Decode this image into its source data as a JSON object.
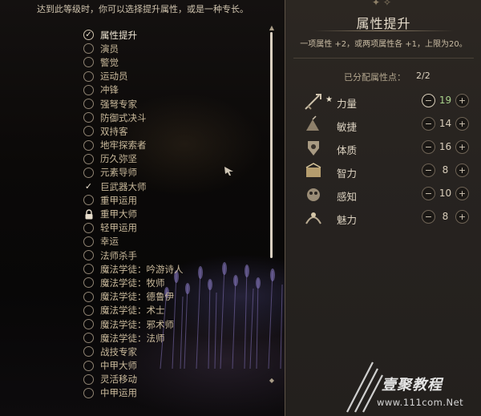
{
  "intro_text": "达到此等级时，你可以选择提升属性，或是一种专长。",
  "feats": [
    {
      "label": "属性提升",
      "state": "checked-circle"
    },
    {
      "label": "演员",
      "state": "empty"
    },
    {
      "label": "警觉",
      "state": "empty"
    },
    {
      "label": "运动员",
      "state": "empty"
    },
    {
      "label": "冲锋",
      "state": "empty"
    },
    {
      "label": "强弩专家",
      "state": "empty"
    },
    {
      "label": "防御式决斗",
      "state": "empty"
    },
    {
      "label": "双持客",
      "state": "empty"
    },
    {
      "label": "地牢探索者",
      "state": "empty"
    },
    {
      "label": "历久弥坚",
      "state": "empty"
    },
    {
      "label": "元素导师",
      "state": "empty"
    },
    {
      "label": "巨武器大师",
      "state": "check"
    },
    {
      "label": "重甲运用",
      "state": "empty"
    },
    {
      "label": "重甲大师",
      "state": "locked"
    },
    {
      "label": "轻甲运用",
      "state": "empty"
    },
    {
      "label": "幸运",
      "state": "empty"
    },
    {
      "label": "法师杀手",
      "state": "empty"
    },
    {
      "label": "魔法学徒：吟游诗人",
      "state": "empty"
    },
    {
      "label": "魔法学徒：牧师",
      "state": "empty"
    },
    {
      "label": "魔法学徒：德鲁伊",
      "state": "empty"
    },
    {
      "label": "魔法学徒：术士",
      "state": "empty"
    },
    {
      "label": "魔法学徒：邪术师",
      "state": "empty"
    },
    {
      "label": "魔法学徒：法师",
      "state": "empty"
    },
    {
      "label": "战技专家",
      "state": "empty"
    },
    {
      "label": "中甲大师",
      "state": "empty"
    },
    {
      "label": "灵活移动",
      "state": "empty"
    },
    {
      "label": "中甲运用",
      "state": "empty"
    }
  ],
  "panel": {
    "title": "属性提升",
    "description": "一项属性 +2，或两项属性各 +1，上限为20。",
    "points_label": "已分配属性点：",
    "points_value": "2/2"
  },
  "attributes": [
    {
      "name": "力量",
      "value": "19",
      "starred": true,
      "boosted": true,
      "icon": "strength-icon"
    },
    {
      "name": "敏捷",
      "value": "14",
      "starred": false,
      "boosted": false,
      "icon": "dexterity-icon"
    },
    {
      "name": "体质",
      "value": "16",
      "starred": false,
      "boosted": false,
      "icon": "constitution-icon"
    },
    {
      "name": "智力",
      "value": "8",
      "starred": false,
      "boosted": false,
      "icon": "intelligence-icon"
    },
    {
      "name": "感知",
      "value": "10",
      "starred": false,
      "boosted": false,
      "icon": "wisdom-icon"
    },
    {
      "name": "魅力",
      "value": "8",
      "starred": false,
      "boosted": false,
      "icon": "charisma-icon"
    }
  ],
  "buttons": {
    "minus": "−",
    "plus": "+",
    "star": "★"
  },
  "watermark": {
    "name": "壹聚教程",
    "url": "www.111com.Net"
  },
  "colors": {
    "boosted_value": "#a9d28c",
    "panel_bg": "#2a2521"
  }
}
